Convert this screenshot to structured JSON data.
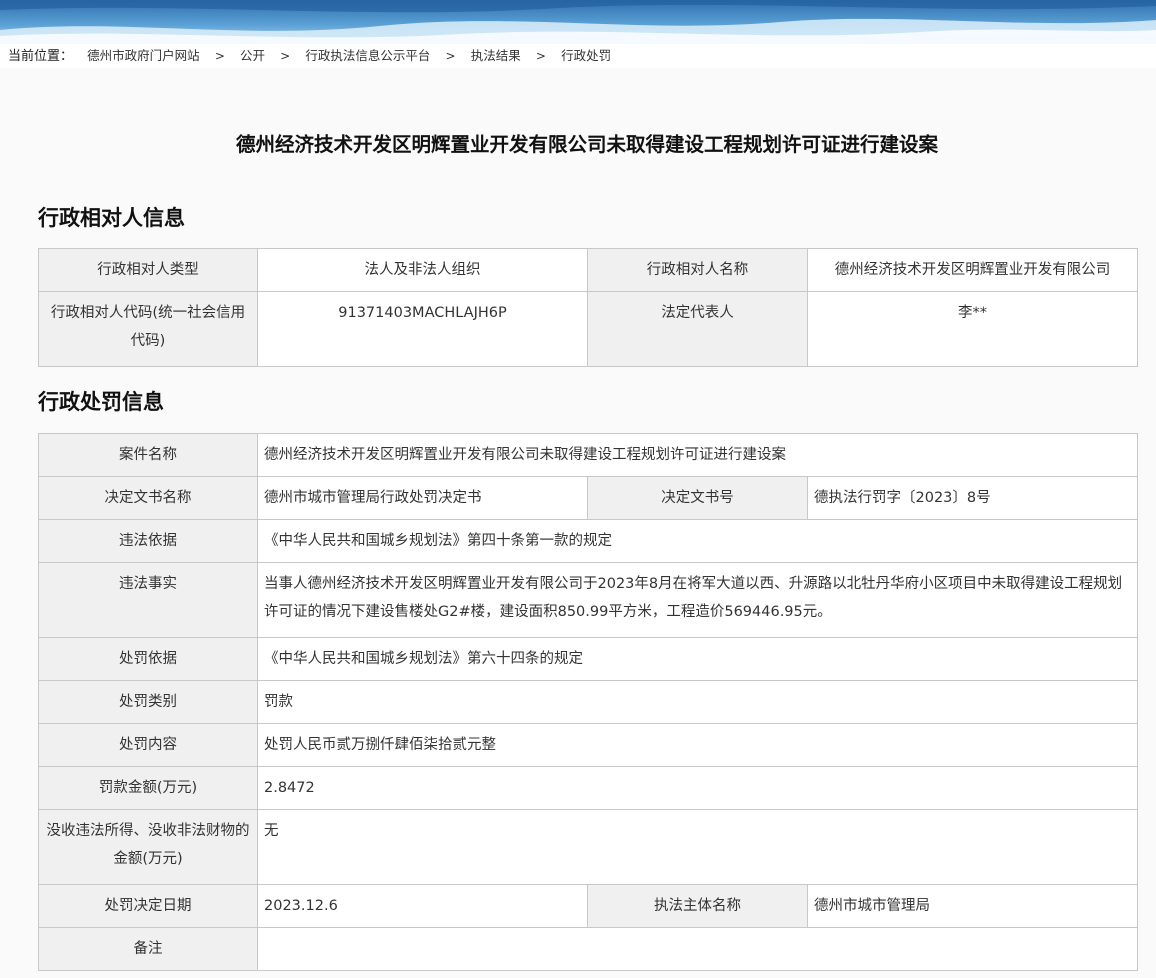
{
  "breadcrumb": {
    "lead": "当前位置：",
    "items": [
      "德州市政府门户网站",
      "公开",
      "行政执法信息公示平台",
      "执法结果",
      "行政处罚"
    ],
    "separator": ">"
  },
  "page_title": "德州经济技术开发区明辉置业开发有限公司未取得建设工程规划许可证进行建设案",
  "party_section": {
    "title": "行政相对人信息",
    "type_label": "行政相对人类型",
    "type_value": "法人及非法人组织",
    "name_label": "行政相对人名称",
    "name_value": "德州经济技术开发区明辉置业开发有限公司",
    "code_label": "行政相对人代码(统一社会信用代码)",
    "code_value": "91371403MACHLAJH6P",
    "rep_label": "法定代表人",
    "rep_value": "李**"
  },
  "penalty_section": {
    "title": "行政处罚信息",
    "case_name_label": "案件名称",
    "case_name_value": "德州经济技术开发区明辉置业开发有限公司未取得建设工程规划许可证进行建设案",
    "doc_name_label": "决定文书名称",
    "doc_name_value": "德州市城市管理局行政处罚决定书",
    "doc_no_label": "决定文书号",
    "doc_no_value": "德执法行罚字〔2023〕8号",
    "violation_basis_label": "违法依据",
    "violation_basis_value": "《中华人民共和国城乡规划法》第四十条第一款的规定",
    "facts_label": "违法事实",
    "facts_value": "当事人德州经济技术开发区明辉置业开发有限公司于2023年8月在将军大道以西、升源路以北牡丹华府小区项目中未取得建设工程规划许可证的情况下建设售楼处G2#楼，建设面积850.99平方米，工程造价569446.95元。",
    "penalty_basis_label": "处罚依据",
    "penalty_basis_value": "《中华人民共和国城乡规划法》第六十四条的规定",
    "category_label": "处罚类别",
    "category_value": "罚款",
    "content_label": "处罚内容",
    "content_value": "处罚人民币贰万捌仟肆佰柒拾贰元整",
    "fine_label": "罚款金额(万元)",
    "fine_value": "2.8472",
    "confiscation_label": "没收违法所得、没收非法财物的金额(万元)",
    "confiscation_value": "无",
    "date_label": "处罚决定日期",
    "date_value": "2023.12.6",
    "agency_label": "执法主体名称",
    "agency_value": "德州市城市管理局",
    "remark_label": "备注",
    "remark_value": ""
  }
}
